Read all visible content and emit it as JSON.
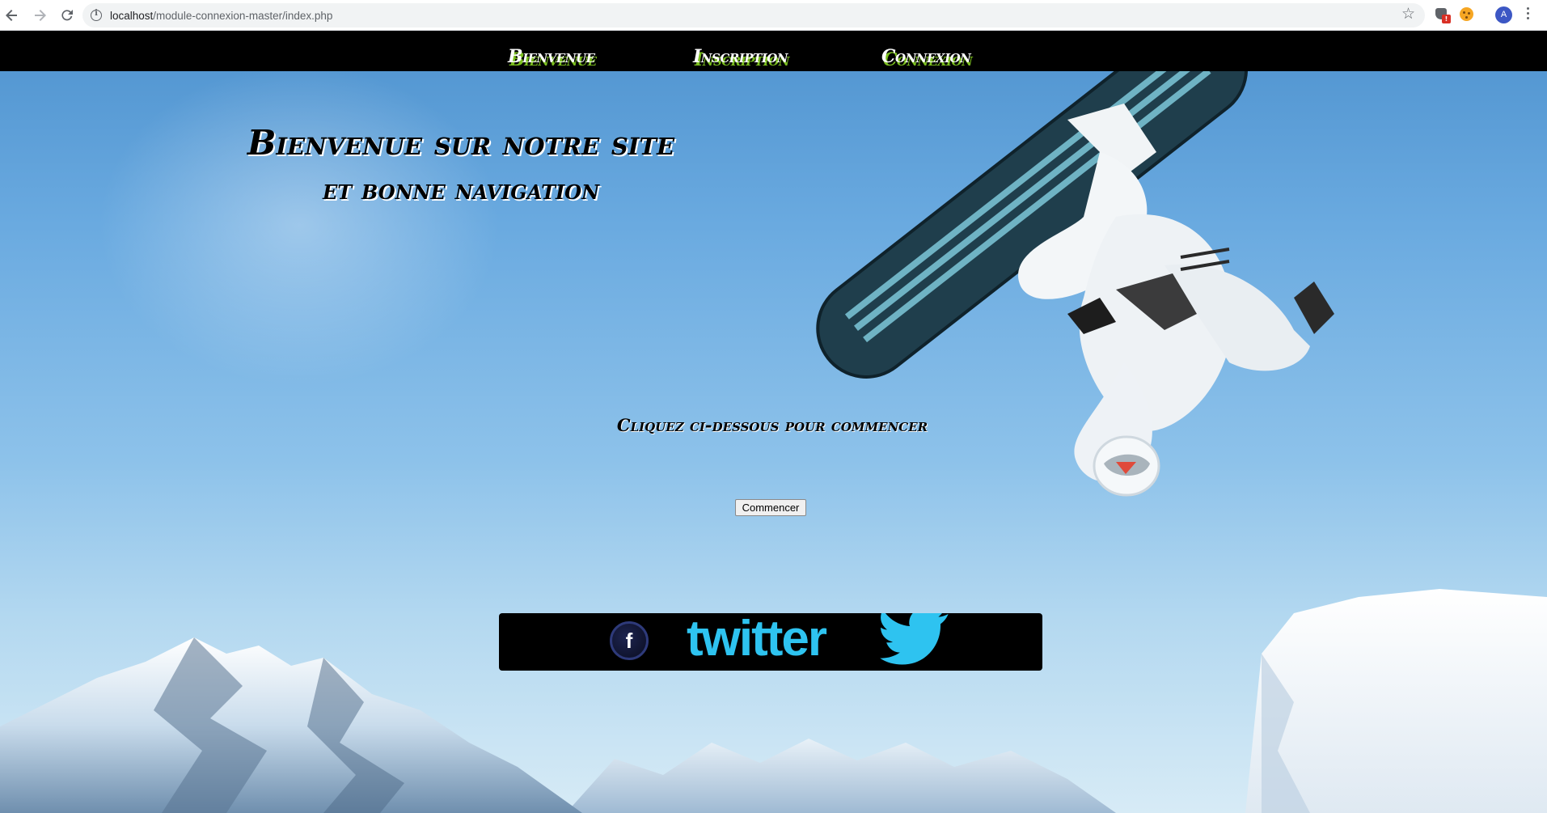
{
  "browser": {
    "url_host": "localhost",
    "url_path": "/module-connexion-master/index.php",
    "avatar_letter": "A",
    "ext_badge": "!"
  },
  "nav": {
    "items": [
      {
        "label": "Bienvenue"
      },
      {
        "label": "Inscription"
      },
      {
        "label": "Connexion"
      }
    ]
  },
  "hero": {
    "line1": "Bienvenue sur notre site",
    "line2": "et bonne navigation"
  },
  "cta": {
    "prompt": "Cliquez ci-dessous pour commencer",
    "button_label": "Commencer"
  },
  "social": {
    "facebook_letter": "f",
    "twitter_label": "twitter"
  },
  "colors": {
    "nav_bg": "#000000",
    "nav_shadow": "#7bbf1f",
    "twitter_blue": "#2ec3f0",
    "facebook_ring": "#2e3a7a",
    "sky_top": "#4f93cf",
    "sky_bottom": "#d7ebf6"
  },
  "icons": [
    "back-arrow-icon",
    "forward-arrow-icon",
    "reload-icon",
    "info-icon",
    "star-icon",
    "extension-shield-icon",
    "cookie-extension-icon",
    "profile-avatar",
    "menu-icon",
    "facebook-icon",
    "twitter-bird-icon"
  ]
}
